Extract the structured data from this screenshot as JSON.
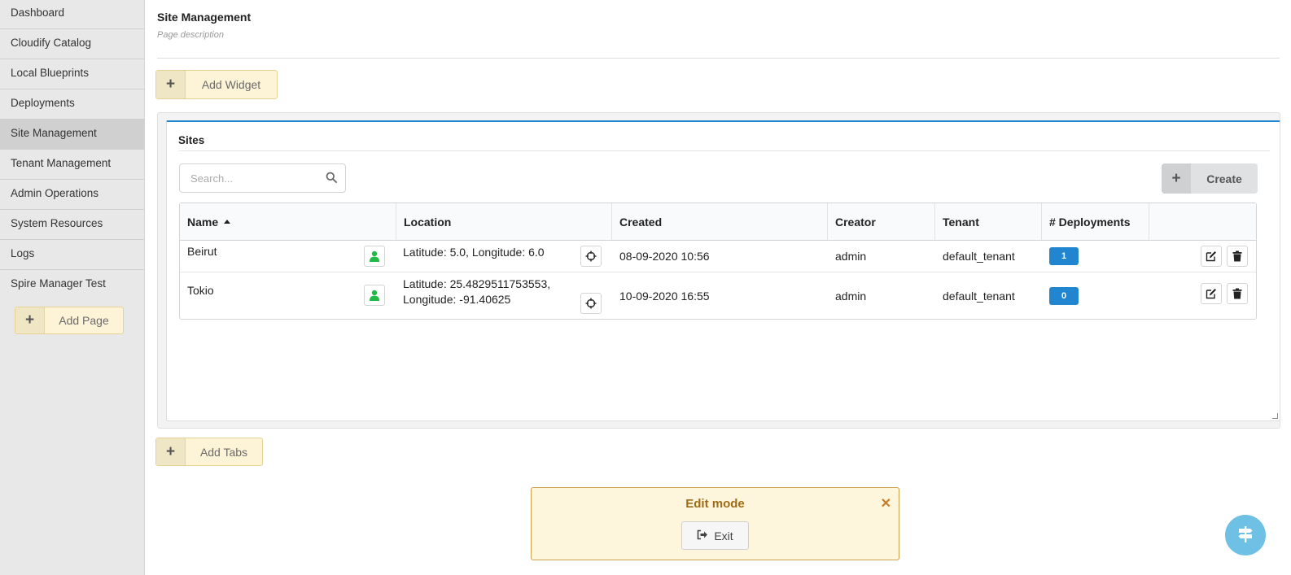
{
  "sidebar": {
    "items": [
      {
        "label": "Dashboard"
      },
      {
        "label": "Cloudify Catalog"
      },
      {
        "label": "Local Blueprints"
      },
      {
        "label": "Deployments"
      },
      {
        "label": "Site Management"
      },
      {
        "label": "Tenant Management"
      },
      {
        "label": "Admin Operations"
      },
      {
        "label": "System Resources"
      },
      {
        "label": "Logs"
      },
      {
        "label": "Spire Manager Test"
      }
    ],
    "active_index": 4,
    "add_page_label": "Add Page"
  },
  "page": {
    "title": "Site Management",
    "description": "Page description",
    "add_widget_label": "Add Widget",
    "add_tabs_label": "Add Tabs"
  },
  "widget": {
    "title": "Sites",
    "search_placeholder": "Search...",
    "create_label": "Create",
    "columns": [
      "Name",
      "Location",
      "Created",
      "Creator",
      "Tenant",
      "# Deployments"
    ],
    "sort_column": "Name",
    "sort_direction": "ascending",
    "rows": [
      {
        "name": "Beirut",
        "location": "Latitude: 5.0, Longitude: 6.0",
        "created": "08-09-2020 10:56",
        "creator": "admin",
        "tenant": "default_tenant",
        "deployments": "1"
      },
      {
        "name": "Tokio",
        "location": "Latitude: 25.4829511753553, Longitude: -91.40625",
        "created": "10-09-2020 16:55",
        "creator": "admin",
        "tenant": "default_tenant",
        "deployments": "0"
      }
    ]
  },
  "edit_mode": {
    "title": "Edit mode",
    "exit_label": "Exit"
  },
  "colors": {
    "accent": "#2185d0",
    "badge": "#2185d0",
    "user_icon": "#21ba45",
    "edit_panel_bg": "#fdf6dc",
    "edit_title": "#9e6b16",
    "fab": "#6ec1e4"
  },
  "icons": [
    "plus-icon",
    "search-icon",
    "user-icon",
    "crosshairs-icon",
    "edit-icon",
    "trash-icon",
    "close-icon",
    "sign-out-icon",
    "signpost-icon"
  ]
}
